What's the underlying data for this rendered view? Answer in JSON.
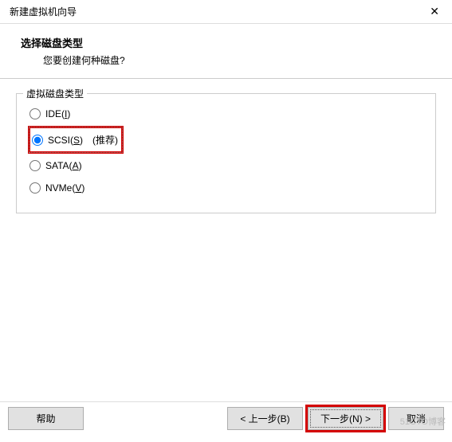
{
  "titlebar": {
    "title": "新建虚拟机向导",
    "close": "✕"
  },
  "header": {
    "title": "选择磁盘类型",
    "subtitle": "您要创建何种磁盘?"
  },
  "fieldset": {
    "legend": "虚拟磁盘类型",
    "options": [
      {
        "prefix": "IDE(",
        "key": "I",
        "suffix": ")"
      },
      {
        "prefix": "SCSI(",
        "key": "S",
        "suffix": ")　(推荐)"
      },
      {
        "prefix": "SATA(",
        "key": "A",
        "suffix": ")"
      },
      {
        "prefix": "NVMe(",
        "key": "V",
        "suffix": ")"
      }
    ]
  },
  "buttons": {
    "help": "帮助",
    "back": "< 上一步(B)",
    "next": "下一步(N) >",
    "cancel": "取消"
  },
  "watermark": "51CTO博客"
}
